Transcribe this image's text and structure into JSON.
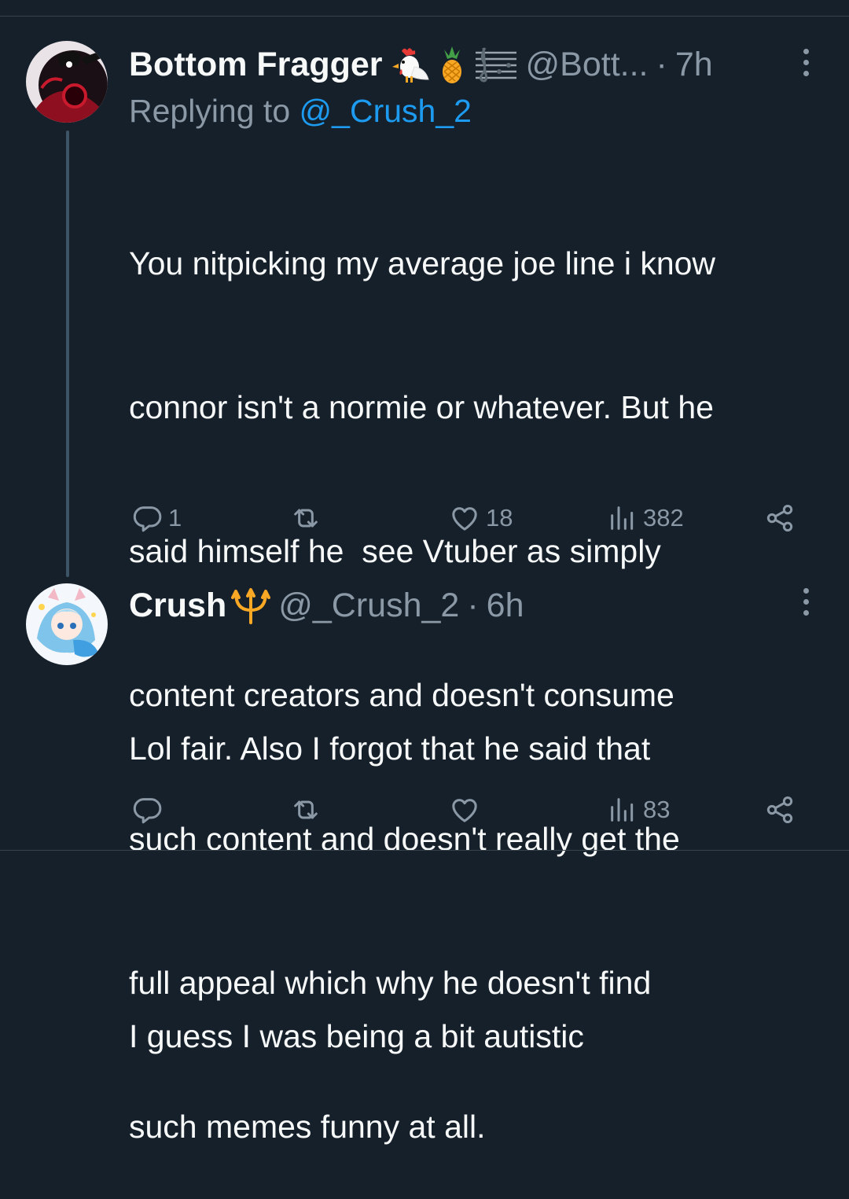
{
  "colors": {
    "background": "#15202b",
    "text_primary": "#f7f9f9",
    "text_secondary": "#8b98a5",
    "link": "#1d9bf0",
    "thread_line": "#3d5466"
  },
  "tweets": [
    {
      "name": "Bottom Fragger",
      "name_emojis": [
        "rooster-emoji",
        "pineapple-emoji",
        "musical-score-emoji"
      ],
      "handle": "@Bott...",
      "separator": "·",
      "time": "7h",
      "replying_prefix": "Replying to",
      "replying_to": "@_Crush_2",
      "text_lines": [
        "You nitpicking my average joe line i know",
        "connor isn't a normie or whatever. But he",
        "said himself he  see Vtuber as simply",
        "content creators and doesn't consume",
        "such content and doesn't really get the",
        "full appeal which why he doesn't find",
        "such memes funny at all."
      ],
      "actions": {
        "replies": "1",
        "retweets": "",
        "likes": "18",
        "views": "382"
      }
    },
    {
      "name": "Crush",
      "name_emojis": [
        "trident-emoji"
      ],
      "handle": "@_Crush_2",
      "separator": "·",
      "time": "6h",
      "text_line_1": "Lol fair. Also I forgot that he said that",
      "text_line_2": "I guess I was being a bit autistic",
      "actions": {
        "replies": "",
        "retweets": "",
        "likes": "",
        "views": "83"
      }
    }
  ],
  "icons": {
    "reply": "reply-icon",
    "retweet": "retweet-icon",
    "like": "heart-icon",
    "views": "views-icon",
    "share": "share-icon",
    "more": "more-icon"
  }
}
